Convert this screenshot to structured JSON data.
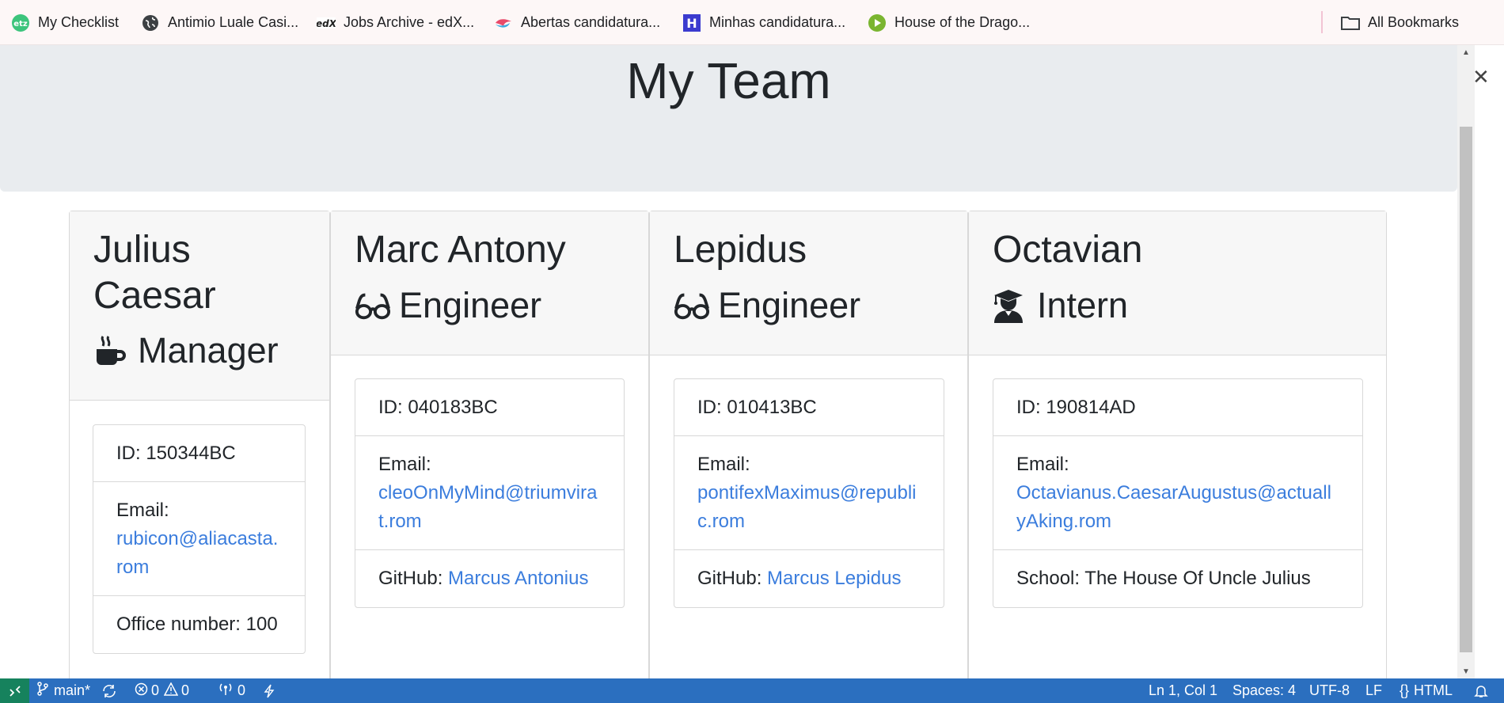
{
  "bookmarks": [
    {
      "label": "My Checklist",
      "icon": "etz-icon"
    },
    {
      "label": "Antimio Luale Casi...",
      "icon": "globe-icon"
    },
    {
      "label": "Jobs Archive - edX...",
      "icon": "edx-icon"
    },
    {
      "label": "Abertas candidatura...",
      "icon": "bird-icon"
    },
    {
      "label": "Minhas candidatura...",
      "icon": "h-icon"
    },
    {
      "label": "House of the Drago...",
      "icon": "play-icon"
    }
  ],
  "all_bookmarks": "All Bookmarks",
  "page_title": "My Team",
  "team": [
    {
      "name": "Julius Caesar",
      "role": "Manager",
      "role_icon": "mug-icon",
      "id": "ID: 150344BC",
      "email_label": "Email:",
      "email": "rubicon@aliacasta.rom",
      "extra_label": "Office number: 100",
      "extra_link": ""
    },
    {
      "name": "Marc Antony",
      "role": "Engineer",
      "role_icon": "glasses-icon",
      "id": "ID: 040183BC",
      "email_label": "Email:",
      "email": "cleoOnMyMind@triumvirat.rom",
      "extra_label": "GitHub: ",
      "extra_link": "Marcus Antonius"
    },
    {
      "name": "Lepidus",
      "role": "Engineer",
      "role_icon": "glasses-icon",
      "id": "ID: 010413BC",
      "email_label": "Email:",
      "email": "pontifexMaximus@republic.rom",
      "extra_label": "GitHub: ",
      "extra_link": "Marcus Lepidus"
    },
    {
      "name": "Octavian",
      "role": "Intern",
      "role_icon": "graduate-icon",
      "id": "ID: 190814AD",
      "email_label": "Email:",
      "email": "Octavianus.CaesarAugustus@actuallyAking.rom",
      "extra_label": "School: The House Of Uncle Julius",
      "extra_link": ""
    }
  ],
  "status_bar": {
    "branch": "main*",
    "errors": "0",
    "warnings": "0",
    "ports": "0",
    "position": "Ln 1, Col 1",
    "spaces": "Spaces: 4",
    "encoding": "UTF-8",
    "eol": "LF",
    "language": "HTML"
  },
  "colors": {
    "status_bar": "#2b6fbf",
    "link": "#3b7ddd",
    "jumbotron": "#e9ecef"
  }
}
